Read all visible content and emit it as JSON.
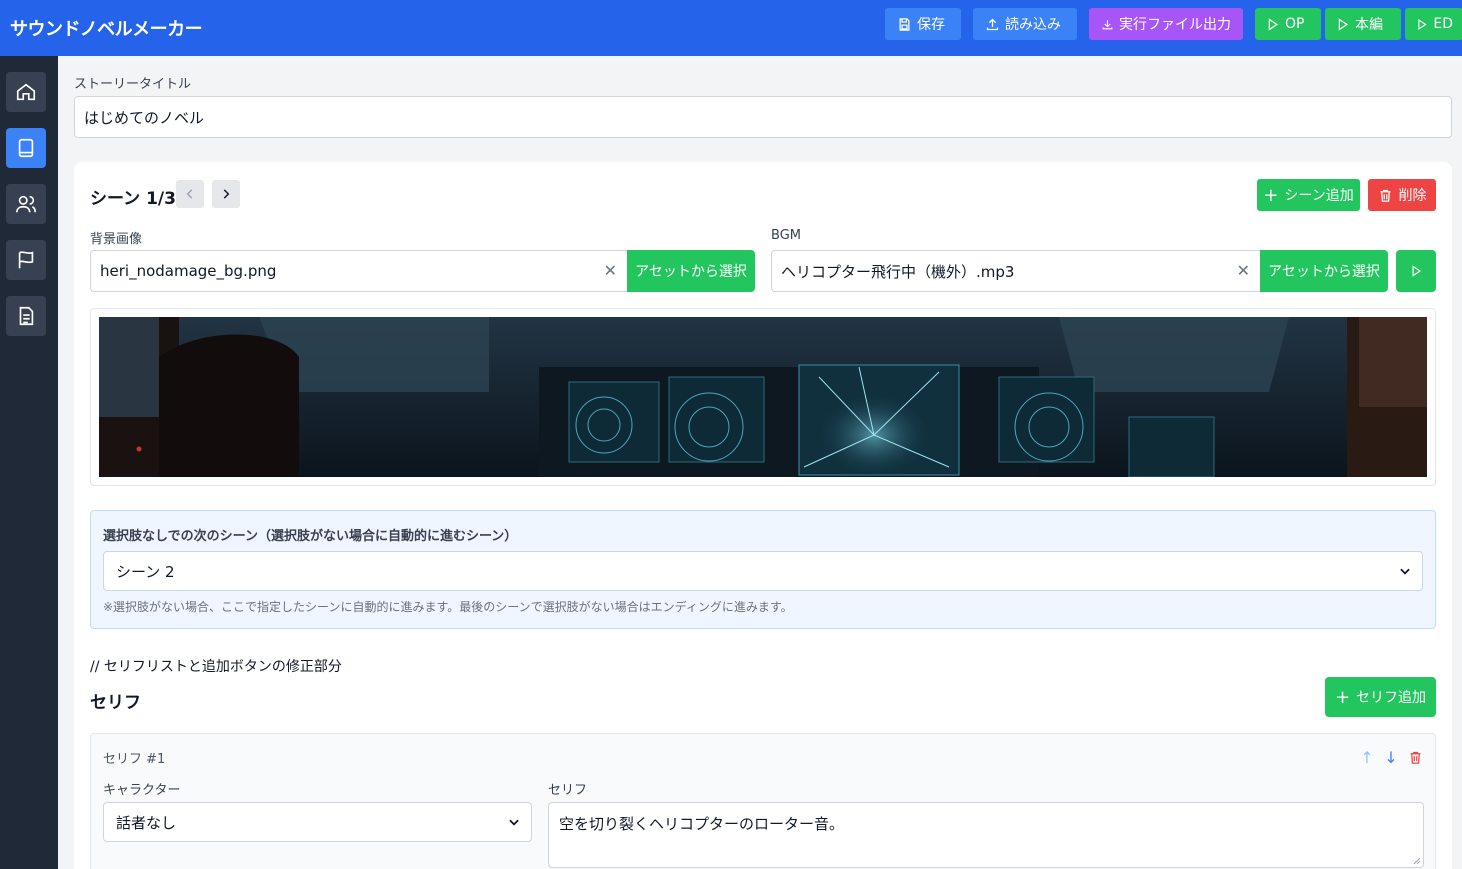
{
  "header": {
    "app_title": "サウンドノベルメーカー",
    "buttons": {
      "save": "保存",
      "load": "読み込み",
      "export": "実行ファイル出力",
      "op": "OP",
      "main": "本編",
      "ed": "ED"
    }
  },
  "sidebar": {
    "items": [
      {
        "icon": "home-icon"
      },
      {
        "icon": "book-icon",
        "active": true
      },
      {
        "icon": "users-icon"
      },
      {
        "icon": "flag-icon"
      },
      {
        "icon": "document-icon"
      }
    ]
  },
  "story": {
    "label": "ストーリータイトル",
    "value": "はじめてのノベル"
  },
  "scene": {
    "title": "シーン 1/3",
    "add_label": "シーン追加",
    "delete_label": "削除",
    "background": {
      "label": "背景画像",
      "value": "heri_nodamage_bg.png",
      "asset_button": "アセットから選択"
    },
    "bgm": {
      "label": "BGM",
      "value": "ヘリコプター飛行中（機外）.mp3",
      "asset_button": "アセットから選択"
    },
    "next_scene": {
      "title": "選択肢なしでの次のシーン（選択肢がない場合に自動的に進むシーン）",
      "selected": "シーン 2",
      "hint": "※選択肢がない場合、ここで指定したシーンに自動的に進みます。最後のシーンで選択肢がない場合はエンディングに進みます。"
    }
  },
  "lines": {
    "comment": "// セリフリストと追加ボタンの修正部分",
    "title": "セリフ",
    "add_label": "セリフ追加",
    "items": [
      {
        "number": "セリフ #1",
        "character_label": "キャラクター",
        "character": "話者なし",
        "text_label": "セリフ",
        "text": "空を切り裂くヘリコプターのローター音。"
      }
    ]
  },
  "colors": {
    "header": "#2563eb",
    "sidebar": "#1f2937",
    "accent_green": "#22c55e",
    "accent_red": "#ef4444",
    "accent_purple": "#a855f7"
  }
}
